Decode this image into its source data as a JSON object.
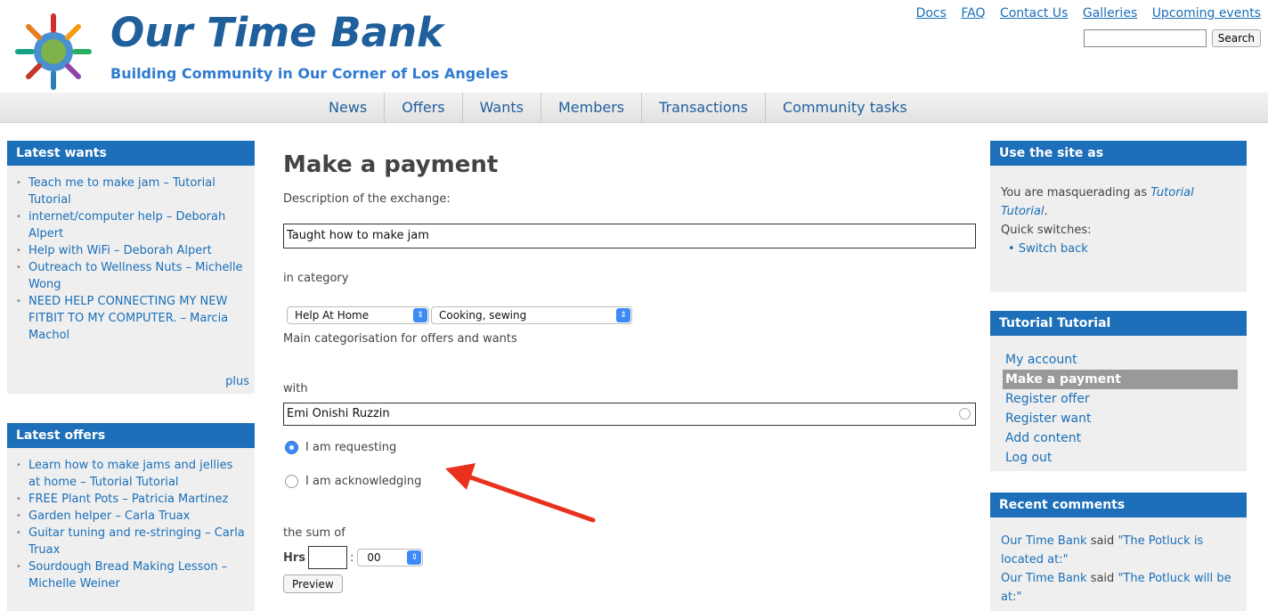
{
  "header": {
    "site_name": "Our Time Bank",
    "slogan": "Building Community in Our Corner of Los Angeles",
    "top_links": [
      "Docs",
      "FAQ",
      "Contact Us",
      "Galleries",
      "Upcoming events"
    ],
    "search_button": "Search",
    "search_value": ""
  },
  "nav": [
    "News",
    "Offers",
    "Wants",
    "Members",
    "Transactions",
    "Community tasks"
  ],
  "latest_wants": {
    "title": "Latest wants",
    "items": [
      "Teach me to make jam – Tutorial Tutorial",
      "internet/computer help – Deborah Alpert",
      "Help with WiFi – Deborah Alpert",
      "Outreach to Wellness Nuts – Michelle Wong",
      "NEED HELP CONNECTING MY NEW FITBIT TO MY COMPUTER. – Marcia Machol"
    ],
    "more": "plus"
  },
  "latest_offers": {
    "title": "Latest offers",
    "items": [
      "Learn how to make jams and jellies at home – Tutorial Tutorial",
      "FREE Plant Pots – Patricia Martinez",
      "Garden helper – Carla Truax",
      "Guitar tuning and re-stringing – Carla Truax",
      "Sourdough Bread Making Lesson – Michelle Weiner"
    ]
  },
  "main": {
    "title": "Make a payment",
    "desc_label": "Description of the exchange:",
    "desc_value": "Taught how to make jam",
    "category_label": "in category",
    "category1": "Help At Home",
    "category2": "Cooking, sewing",
    "category_help": "Main categorisation for offers and wants",
    "with_label": "with",
    "with_value": "Emi Onishi Ruzzin",
    "radio_requesting": "I am requesting",
    "radio_acknowledging": "I am acknowledging",
    "sum_label": "the sum of",
    "hrs_label": "Hrs",
    "hrs_value": "",
    "colon": ":",
    "minutes": "00",
    "preview_button": "Preview"
  },
  "masquerade": {
    "title": "Use the site as",
    "text_prefix": "You are masquerading as ",
    "user": "Tutorial Tutorial",
    "text_suffix": ".",
    "quick_label": "Quick switches:",
    "switch_back": "Switch back"
  },
  "user_menu": {
    "title": "Tutorial Tutorial",
    "links": [
      "My account",
      "Make a payment",
      "Register offer",
      "Register want",
      "Add content",
      "Log out"
    ],
    "active": "Make a payment"
  },
  "recent_comments": {
    "title": "Recent comments",
    "items": [
      {
        "author": "Our Time Bank",
        "said": " said ",
        "text": "\"The Potluck is located at:\""
      },
      {
        "author": "Our Time Bank",
        "said": " said ",
        "text": "\"The Potluck will be at:\""
      }
    ]
  },
  "colors": {
    "brand_blue": "#1c6fb8",
    "title_blue": "#1f5f9c",
    "arrow_red": "#e8321e"
  },
  "icons": [
    "logo-circle-of-people-icon",
    "select-arrow-icon",
    "autocomplete-icon",
    "annotation-arrow-icon"
  ]
}
